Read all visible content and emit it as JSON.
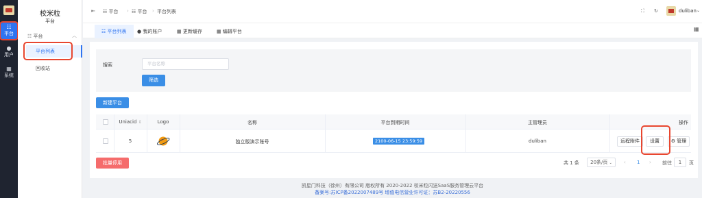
{
  "rail": {
    "items": [
      {
        "label": "平台",
        "icon": "☷"
      },
      {
        "label": "用户",
        "icon": "●"
      },
      {
        "label": "系统",
        "icon": "▦"
      }
    ]
  },
  "menu": {
    "title": "校米粒",
    "subtitle": "平台",
    "group": "平台",
    "links": [
      "平台列表",
      "回收站"
    ]
  },
  "header": {
    "breadcrumb": [
      "平台",
      "平台",
      "平台列表"
    ],
    "username": "duliban"
  },
  "tabs": [
    "平台列表",
    "我的账户",
    "更新缓存",
    "编辑平台"
  ],
  "filter": {
    "search_label": "搜索",
    "search_placeholder": "平台名称",
    "filter_button": "筛选"
  },
  "actions": {
    "new_platform": "新建平台",
    "bulk_disable": "批量停用"
  },
  "table": {
    "headers": [
      "Uniacid",
      "Logo",
      "名称",
      "平台到期时间",
      "主管理员",
      "操作"
    ],
    "rows": [
      {
        "uniacid": "5",
        "name": "独立版演示账号",
        "expire": "2100-06-15 23:59:59",
        "admin": "duliban",
        "ops": [
          "远程附件",
          "设置",
          "管理"
        ]
      }
    ]
  },
  "pagination": {
    "total": "共 1 条",
    "page_size": "20条/页",
    "prev": "‹",
    "current": "1",
    "next": "›",
    "goto_label": "前往",
    "goto_value": "1",
    "goto_suffix": "页"
  },
  "footer": {
    "copyright": "凯星门科技（徐州）有限公司 版权所有 2020-2022 校米粒闪送SaaS服务管理云平台",
    "icp": "备案号:苏ICP备2022007489号 增值电信营业许可证：苏B2-20220556"
  },
  "colors": {
    "primary": "#3a8ee6",
    "danger": "#f56c6c",
    "highlight": "#e8462f",
    "rail": "#1f2430"
  }
}
